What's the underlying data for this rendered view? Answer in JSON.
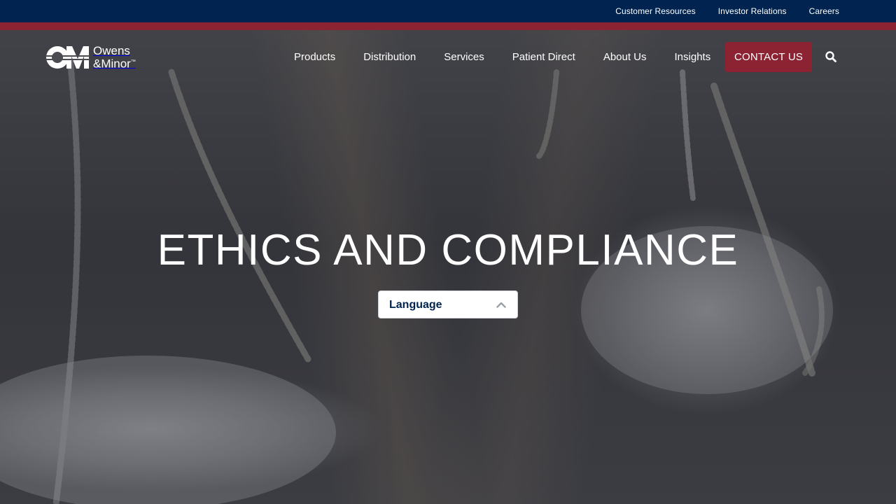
{
  "utility_nav": {
    "items": [
      "Customer Resources",
      "Investor Relations",
      "Careers"
    ]
  },
  "brand": {
    "line1": "Owens",
    "line2": "&Minor",
    "trademark": "™"
  },
  "main_nav": {
    "items": [
      "Products",
      "Distribution",
      "Services",
      "Patient Direct",
      "About Us",
      "Insights"
    ],
    "contact_label": "CONTACT US",
    "search_icon": "search-icon"
  },
  "hero": {
    "title": "ETHICS AND COMPLIANCE",
    "language_select": {
      "selected": "Language",
      "icon": "chevron-up-icon"
    }
  },
  "colors": {
    "navy": "#00244f",
    "brand_red": "#8b2333",
    "white": "#ffffff"
  }
}
